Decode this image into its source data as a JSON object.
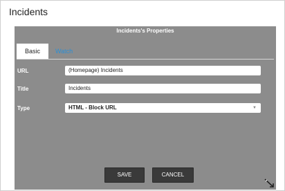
{
  "window": {
    "title": "Incidents"
  },
  "dialog": {
    "header": "Incidents's Properties",
    "tabs": [
      {
        "label": "Basic"
      },
      {
        "label": "Watch"
      }
    ],
    "fields": {
      "url": {
        "label": "URL",
        "value": "(Homepage) Incidents"
      },
      "title": {
        "label": "Title",
        "value": "Incidents"
      },
      "type": {
        "label": "Type",
        "value": "HTML - Block URL"
      }
    },
    "buttons": {
      "save": "SAVE",
      "cancel": "CANCEL"
    },
    "icons": {
      "resize": "resize-handle-icon",
      "dropdown": "chevron-down-icon"
    }
  }
}
